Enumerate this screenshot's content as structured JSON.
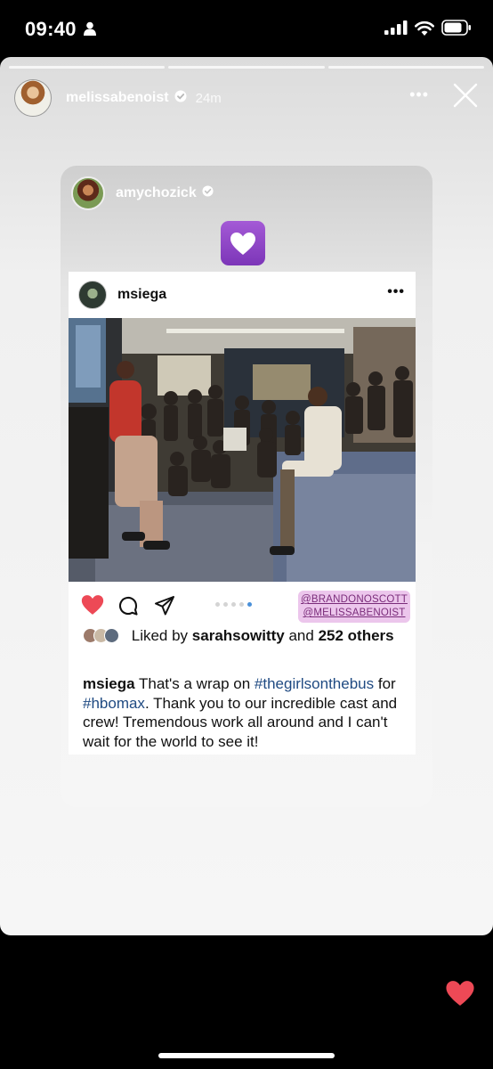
{
  "status_bar": {
    "time": "09:40"
  },
  "story": {
    "username": "melissabenoist",
    "time_ago": "24m",
    "progress_segments": 3
  },
  "shared_by": {
    "username": "amychozick"
  },
  "post": {
    "username": "msiega",
    "tags": [
      "@BRANDONOSCOTT",
      "@MELISSABENOIST"
    ],
    "likes_prefix": "Liked by",
    "likes_user": "sarahsowitty",
    "likes_middle": "and",
    "likes_count": "252 others",
    "caption_user": "msiega",
    "caption_part1": "That's a wrap on",
    "hashtag1": "#thegirlsonthebus",
    "caption_part2": "for",
    "hashtag2": "#hbomax",
    "caption_part3": ". Thank you to our incredible cast and crew! Tremendous work all around and I can't wait for the world to see it!",
    "carousel_dots": 5,
    "carousel_active_index": 4
  },
  "colors": {
    "like_red": "#ed4956",
    "hashtag_blue": "#1f4a82",
    "tag_bg": "#ecc6ec",
    "heart_emoji_purple": "#8e44c7"
  },
  "icons": [
    "person-icon",
    "signal-icon",
    "wifi-icon",
    "battery-icon",
    "verified-icon",
    "more-icon",
    "close-icon",
    "purple-heart-icon",
    "heart-icon",
    "comment-icon",
    "share-icon"
  ]
}
